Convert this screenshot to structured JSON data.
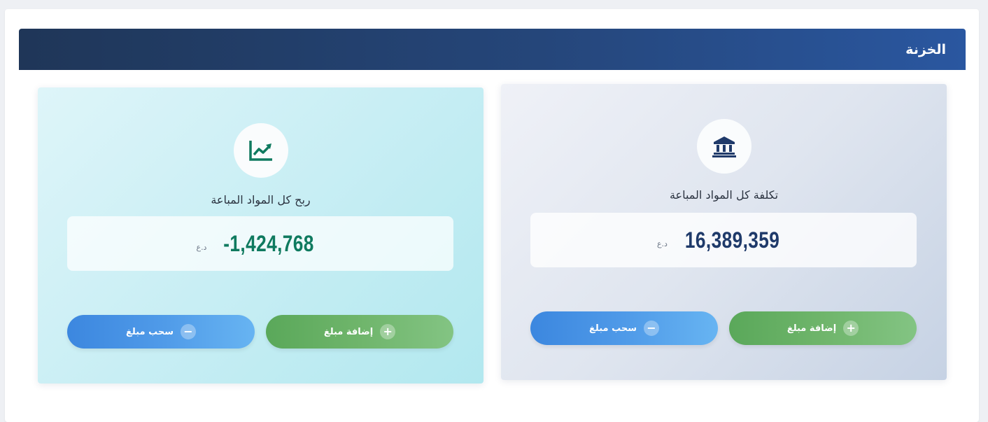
{
  "header": {
    "title": "الخزنة"
  },
  "cards": {
    "cost": {
      "icon": "bank-icon",
      "label": "تكلفة كل المواد المباعة",
      "amount": "16,389,359",
      "currency": "د.ع",
      "add_label": "إضافة مبلغ",
      "sub_label": "سحب مبلغ"
    },
    "profit": {
      "icon": "chart-line-icon",
      "label": "ربح كل المواد المباعة",
      "amount": "-1,424,768",
      "currency": "د.ع",
      "add_label": "إضافة مبلغ",
      "sub_label": "سحب مبلغ"
    }
  },
  "colors": {
    "header": "#25467a",
    "cost_amount": "#1f3a6a",
    "profit_amount": "#0f7a5f",
    "add_button": "#6fb56b",
    "subtract_button": "#4f9ae8"
  }
}
